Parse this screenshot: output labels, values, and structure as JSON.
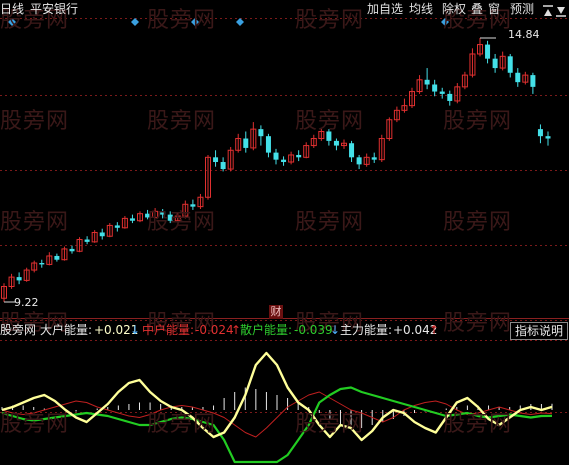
{
  "top_bar": {
    "chart_mode": "日线",
    "stock_name": "平安银行",
    "buttons": [
      "加自选",
      "均线",
      "除权",
      "叠",
      "窗",
      "预测"
    ]
  },
  "price_chart": {
    "high_label": "14.84",
    "low_label": "9.22",
    "fin_badge": "财"
  },
  "indicator": {
    "name": "股旁网",
    "items": [
      {
        "label": "大户能量:",
        "value": "+0.021",
        "arrow": "↓",
        "color": "#e8e8e8",
        "arrow_color": "#4fb0ff"
      },
      {
        "label": "中户能量:",
        "value": "-0.024",
        "arrow": "↑",
        "color": "#e03030",
        "arrow_color": "#e03030"
      },
      {
        "label": "散户能量:",
        "value": "-0.039",
        "arrow": "↓",
        "color": "#2ecc2e",
        "arrow_color": "#4fb0ff"
      },
      {
        "label": "主力能量:",
        "value": "+0.042",
        "arrow": "↑",
        "color": "#e8e8e8",
        "arrow_color": "#e03030"
      }
    ],
    "help_button": "指标说明"
  },
  "watermark": "股旁网",
  "colors": {
    "up": "#e03030",
    "down": "#44e0e8",
    "grid": "#7a1a1a",
    "diamond": "#3aa0e0",
    "big": "#ffff99",
    "mid": "#c02020",
    "small": "#22cc22"
  },
  "chart_data": {
    "type": "candlestick",
    "price_range": [
      9.22,
      14.84
    ],
    "candles": [
      [
        9.3,
        9.55,
        9.22,
        9.62
      ],
      [
        9.55,
        9.75,
        9.5,
        9.82
      ],
      [
        9.75,
        9.68,
        9.6,
        9.85
      ],
      [
        9.68,
        9.9,
        9.65,
        9.95
      ],
      [
        9.9,
        10.05,
        9.85,
        10.1
      ],
      [
        10.05,
        10.02,
        9.95,
        10.12
      ],
      [
        10.02,
        10.2,
        10.0,
        10.28
      ],
      [
        10.2,
        10.12,
        10.08,
        10.25
      ],
      [
        10.12,
        10.35,
        10.1,
        10.4
      ],
      [
        10.35,
        10.3,
        10.25,
        10.42
      ],
      [
        10.3,
        10.55,
        10.28,
        10.6
      ],
      [
        10.55,
        10.5,
        10.45,
        10.62
      ],
      [
        10.5,
        10.7,
        10.48,
        10.75
      ],
      [
        10.7,
        10.62,
        10.55,
        10.78
      ],
      [
        10.62,
        10.85,
        10.6,
        10.9
      ],
      [
        10.85,
        10.8,
        10.72,
        10.92
      ],
      [
        10.8,
        11.0,
        10.78,
        11.05
      ],
      [
        11.0,
        10.95,
        10.9,
        11.08
      ],
      [
        10.95,
        11.1,
        10.92,
        11.15
      ],
      [
        11.1,
        11.02,
        10.98,
        11.18
      ],
      [
        11.02,
        11.15,
        11.0,
        11.22
      ],
      [
        11.15,
        11.08,
        11.0,
        11.2
      ],
      [
        11.08,
        10.95,
        10.9,
        11.15
      ],
      [
        10.95,
        11.05,
        10.92,
        11.12
      ],
      [
        11.05,
        11.3,
        11.0,
        11.38
      ],
      [
        11.3,
        11.25,
        11.18,
        11.4
      ],
      [
        11.25,
        11.45,
        11.2,
        11.52
      ],
      [
        11.45,
        12.3,
        11.4,
        12.35
      ],
      [
        12.3,
        12.2,
        12.1,
        12.45
      ],
      [
        12.2,
        12.05,
        12.0,
        12.3
      ],
      [
        12.05,
        12.45,
        12.0,
        12.52
      ],
      [
        12.45,
        12.7,
        12.4,
        12.8
      ],
      [
        12.7,
        12.5,
        12.4,
        12.85
      ],
      [
        12.5,
        12.9,
        12.45,
        13.05
      ],
      [
        12.9,
        12.75,
        12.55,
        12.98
      ],
      [
        12.75,
        12.4,
        12.3,
        12.8
      ],
      [
        12.4,
        12.25,
        12.15,
        12.48
      ],
      [
        12.25,
        12.2,
        12.12,
        12.32
      ],
      [
        12.2,
        12.35,
        12.15,
        12.42
      ],
      [
        12.35,
        12.3,
        12.22,
        12.45
      ],
      [
        12.3,
        12.55,
        12.28,
        12.62
      ],
      [
        12.55,
        12.7,
        12.5,
        12.78
      ],
      [
        12.7,
        12.85,
        12.65,
        12.92
      ],
      [
        12.85,
        12.65,
        12.55,
        12.9
      ],
      [
        12.65,
        12.55,
        12.45,
        12.7
      ],
      [
        12.55,
        12.6,
        12.48,
        12.68
      ],
      [
        12.6,
        12.3,
        12.2,
        12.65
      ],
      [
        12.3,
        12.15,
        12.05,
        12.35
      ],
      [
        12.15,
        12.3,
        12.1,
        12.38
      ],
      [
        12.3,
        12.25,
        12.18,
        12.4
      ],
      [
        12.25,
        12.7,
        12.2,
        12.78
      ],
      [
        12.7,
        13.1,
        12.65,
        13.15
      ],
      [
        13.1,
        13.3,
        13.05,
        13.38
      ],
      [
        13.3,
        13.4,
        13.25,
        13.55
      ],
      [
        13.4,
        13.7,
        13.35,
        13.78
      ],
      [
        13.7,
        13.95,
        13.65,
        14.05
      ],
      [
        13.95,
        13.85,
        13.75,
        14.2
      ],
      [
        13.85,
        13.7,
        13.6,
        13.95
      ],
      [
        13.7,
        13.65,
        13.55,
        13.78
      ],
      [
        13.65,
        13.5,
        13.4,
        13.72
      ],
      [
        13.5,
        13.8,
        13.45,
        13.88
      ],
      [
        13.8,
        14.05,
        13.75,
        14.12
      ],
      [
        14.05,
        14.5,
        14.0,
        14.62
      ],
      [
        14.5,
        14.7,
        14.45,
        14.84
      ],
      [
        14.7,
        14.4,
        14.3,
        14.78
      ],
      [
        14.4,
        14.2,
        14.1,
        14.5
      ],
      [
        14.2,
        14.45,
        14.15,
        14.55
      ],
      [
        14.45,
        14.1,
        14.0,
        14.5
      ],
      [
        14.1,
        13.9,
        13.8,
        14.2
      ],
      [
        13.9,
        14.05,
        13.85,
        14.12
      ],
      [
        14.05,
        13.8,
        13.65,
        14.1
      ],
      [
        12.9,
        12.75,
        12.6,
        13.0
      ],
      [
        12.75,
        12.7,
        12.55,
        12.85
      ]
    ],
    "indicator_series": {
      "big": [
        0.0,
        0.02,
        0.05,
        0.08,
        0.1,
        0.06,
        0.0,
        -0.05,
        -0.08,
        -0.02,
        0.04,
        0.12,
        0.18,
        0.2,
        0.12,
        0.06,
        0.02,
        0.0,
        -0.05,
        -0.12,
        -0.18,
        -0.15,
        -0.05,
        0.1,
        0.3,
        0.38,
        0.3,
        0.15,
        0.05,
        0.0,
        -0.1,
        -0.18,
        -0.1,
        -0.12,
        -0.2,
        -0.14,
        -0.05,
        0.0,
        -0.02,
        -0.08,
        -0.12,
        -0.15,
        -0.05,
        0.05,
        0.08,
        0.02,
        -0.06,
        -0.1,
        -0.05,
        0.0,
        0.02,
        0.0,
        0.021
      ],
      "mid": [
        0.0,
        -0.02,
        -0.03,
        -0.02,
        0.0,
        0.02,
        0.04,
        0.06,
        0.05,
        0.02,
        0.0,
        -0.02,
        -0.04,
        -0.05,
        -0.03,
        0.0,
        0.02,
        0.03,
        0.02,
        0.0,
        -0.02,
        -0.05,
        -0.1,
        -0.15,
        -0.18,
        -0.12,
        -0.05,
        0.02,
        0.06,
        0.1,
        0.12,
        0.08,
        0.04,
        0.0,
        -0.02,
        -0.05,
        -0.08,
        -0.05,
        0.0,
        0.03,
        0.05,
        0.06,
        0.04,
        0.0,
        -0.03,
        -0.02,
        0.0,
        0.02,
        0.0,
        -0.02,
        -0.03,
        -0.02,
        -0.024
      ],
      "small": [
        -0.02,
        -0.04,
        -0.06,
        -0.07,
        -0.06,
        -0.05,
        -0.04,
        -0.03,
        -0.02,
        -0.03,
        -0.04,
        -0.06,
        -0.08,
        -0.1,
        -0.1,
        -0.08,
        -0.06,
        -0.05,
        -0.06,
        -0.08,
        -0.1,
        -0.2,
        -0.35,
        -0.4,
        -0.42,
        -0.4,
        -0.35,
        -0.3,
        -0.2,
        -0.1,
        0.05,
        0.1,
        0.14,
        0.15,
        0.12,
        0.1,
        0.08,
        0.06,
        0.04,
        0.02,
        0.0,
        -0.02,
        -0.04,
        -0.03,
        -0.02,
        -0.04,
        -0.05,
        -0.04,
        -0.03,
        -0.04,
        -0.05,
        -0.04,
        -0.039
      ],
      "main_bars": [
        0.02,
        0.03,
        0.03,
        0.02,
        0.01,
        0.0,
        -0.01,
        -0.01,
        0.0,
        0.01,
        0.02,
        0.03,
        0.04,
        0.05,
        0.05,
        0.04,
        0.03,
        0.02,
        0.02,
        0.02,
        0.03,
        0.08,
        0.12,
        0.15,
        0.14,
        0.12,
        0.1,
        0.08,
        0.05,
        0.02,
        -0.02,
        -0.06,
        -0.1,
        -0.12,
        -0.12,
        -0.1,
        -0.08,
        -0.06,
        -0.04,
        -0.02,
        -0.01,
        0.0,
        0.01,
        0.02,
        0.03,
        0.03,
        0.03,
        0.02,
        0.02,
        0.03,
        0.04,
        0.04,
        0.042
      ]
    }
  }
}
